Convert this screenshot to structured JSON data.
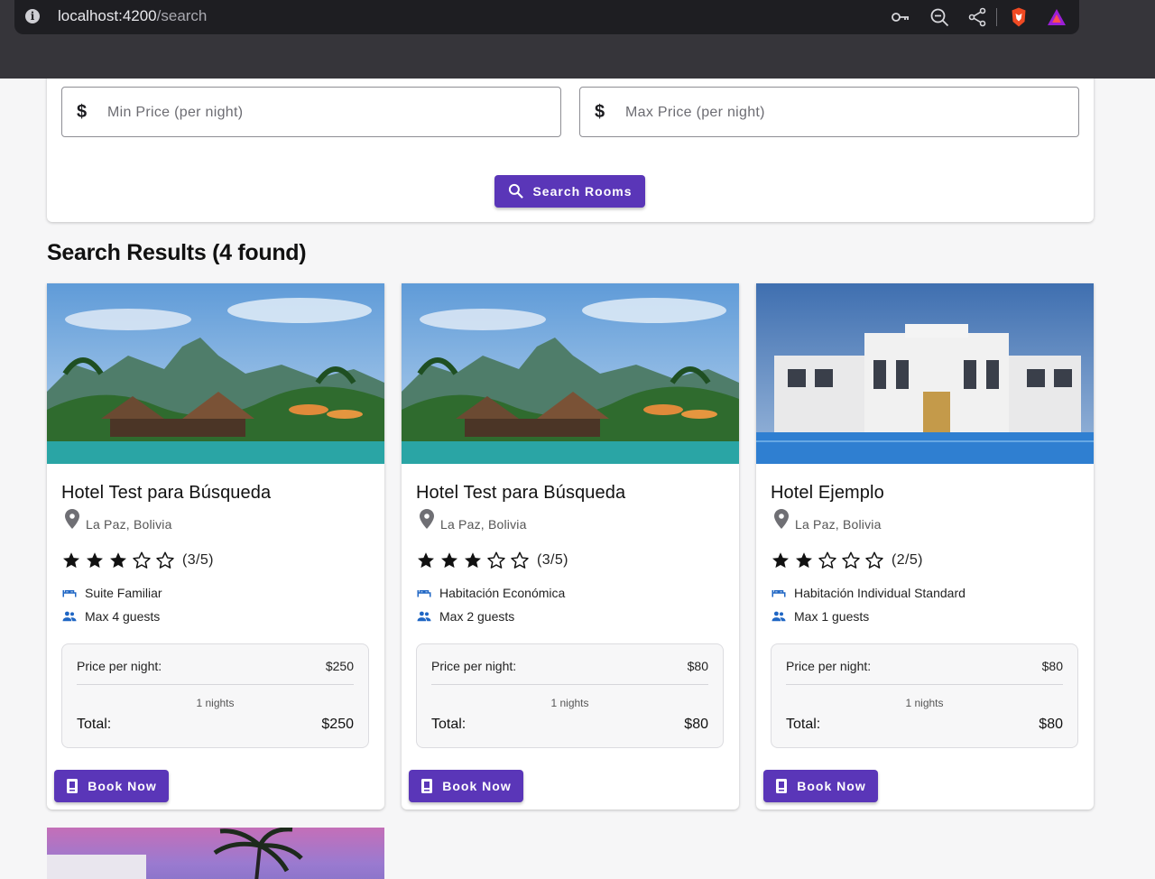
{
  "browser": {
    "url_host": "localhost:4200",
    "url_path": "/search"
  },
  "search": {
    "min_placeholder": "Min Price (per night)",
    "max_placeholder": "Max Price (per night)",
    "currency_symbol": "$",
    "button_label": "Search Rooms"
  },
  "results": {
    "title": "Search Results (4 found)",
    "cards": [
      {
        "name": "Hotel Test para Búsqueda",
        "location": "La Paz, Bolivia",
        "stars": 3,
        "rating_text": "(3/5)",
        "room_type": "Suite Familiar",
        "guests": "Max 4 guests",
        "price_label": "Price per night:",
        "price": "$250",
        "nights": "1 nights",
        "total_label": "Total:",
        "total": "$250",
        "book_label": "Book Now"
      },
      {
        "name": "Hotel Test para Búsqueda",
        "location": "La Paz, Bolivia",
        "stars": 3,
        "rating_text": "(3/5)",
        "room_type": "Habitación Económica",
        "guests": "Max 2 guests",
        "price_label": "Price per night:",
        "price": "$80",
        "nights": "1 nights",
        "total_label": "Total:",
        "total": "$80",
        "book_label": "Book Now"
      },
      {
        "name": "Hotel Ejemplo",
        "location": "La Paz, Bolivia",
        "stars": 2,
        "rating_text": "(2/5)",
        "room_type": "Habitación Individual Standard",
        "guests": "Max 1 guests",
        "price_label": "Price per night:",
        "price": "$80",
        "nights": "1 nights",
        "total_label": "Total:",
        "total": "$80",
        "book_label": "Book Now"
      }
    ]
  },
  "colors": {
    "primary": "#5a36b8",
    "feature_icon": "#1f66c4"
  }
}
